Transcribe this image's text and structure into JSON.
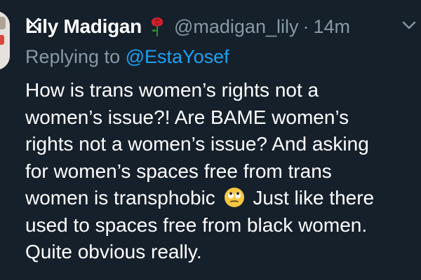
{
  "tweet": {
    "author_name": "Lily Madigan",
    "handle": "@madigan_lily",
    "separator": "·",
    "time": "14m",
    "reply_prefix": "Replying to",
    "reply_mention": "@EstaYosef",
    "body_lines": [
      "How is trans women’s rights not a",
      "women’s issue?! Are BAME women’s",
      "rights not a women’s issue? And asking",
      "for women’s spaces free from trans",
      "women is transphobic",
      "Just like there",
      "used to spaces free from black women.",
      "Quite obvious really."
    ],
    "icons": {
      "close": "close-icon",
      "rose": "rose-icon",
      "chevron": "chevron-down-icon",
      "emoji": "eye-roll-emoji-icon"
    }
  },
  "colors": {
    "background": "#15202b",
    "text": "#ffffff",
    "secondary_text": "#8899a6",
    "link": "#1da1f2",
    "rose": "#d0202e"
  }
}
